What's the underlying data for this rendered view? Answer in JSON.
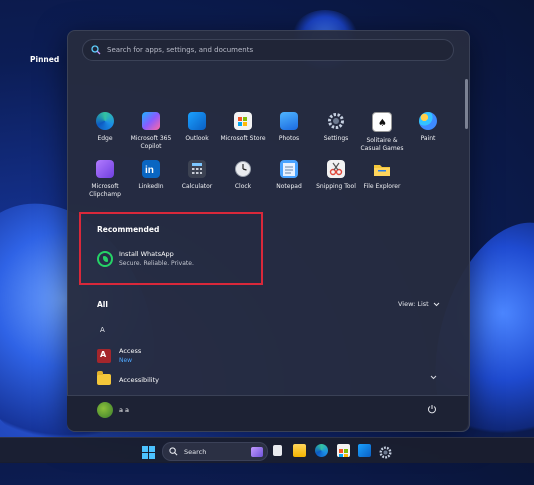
{
  "search": {
    "placeholder": "Search for apps, settings, and documents"
  },
  "pinned": {
    "title": "Pinned",
    "apps": [
      {
        "label": "Edge",
        "icon": "edge-icon"
      },
      {
        "label": "Microsoft 365 Copilot",
        "icon": "copilot-icon"
      },
      {
        "label": "Outlook",
        "icon": "outlook-icon"
      },
      {
        "label": "Microsoft Store",
        "icon": "store-icon"
      },
      {
        "label": "Photos",
        "icon": "photos-icon"
      },
      {
        "label": "Settings",
        "icon": "settings-icon"
      },
      {
        "label": "Solitaire & Casual Games",
        "icon": "solitaire-icon"
      },
      {
        "label": "Paint",
        "icon": "paint-icon"
      },
      {
        "label": "Microsoft Clipchamp",
        "icon": "clipchamp-icon"
      },
      {
        "label": "LinkedIn",
        "icon": "linkedin-icon"
      },
      {
        "label": "Calculator",
        "icon": "calculator-icon"
      },
      {
        "label": "Clock",
        "icon": "clock-icon"
      },
      {
        "label": "Notepad",
        "icon": "notepad-icon"
      },
      {
        "label": "Snipping Tool",
        "icon": "snipping-tool-icon"
      },
      {
        "label": "File Explorer",
        "icon": "file-explorer-icon"
      }
    ]
  },
  "recommended": {
    "title": "Recommended",
    "item": {
      "title": "Install WhatsApp",
      "subtitle": "Secure. Reliable. Private."
    }
  },
  "all": {
    "title": "All",
    "view_label": "View: List",
    "letter": "A",
    "items": [
      {
        "name": "Access",
        "badge": "New"
      },
      {
        "name": "Accessibility"
      }
    ]
  },
  "user": {
    "name": "a a"
  },
  "taskbar": {
    "search_label": "Search"
  },
  "colors": {
    "accent": "#4ea8ff",
    "highlight_border": "#d9283a",
    "whatsapp": "#25d366"
  }
}
